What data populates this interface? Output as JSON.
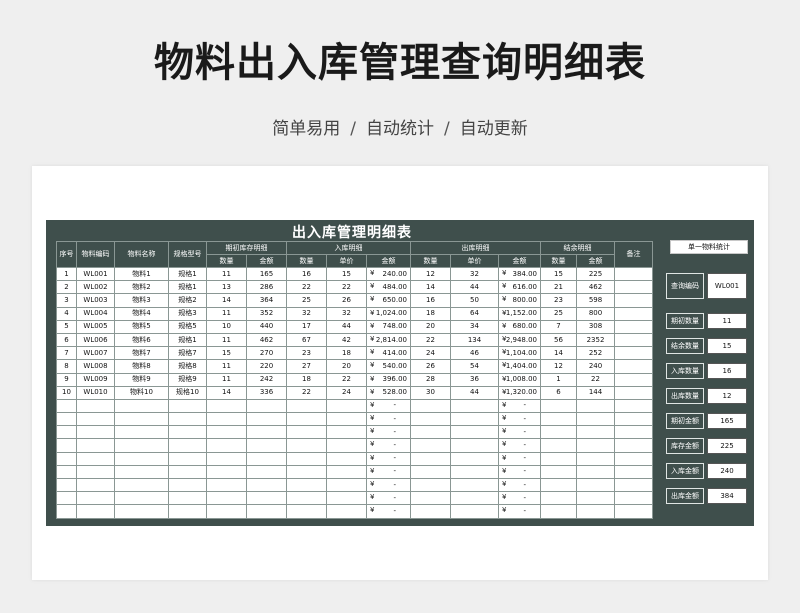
{
  "page": {
    "title": "物料出入库管理查询明细表",
    "subtitle": [
      "简单易用",
      "自动统计",
      "自动更新"
    ],
    "separator": "/"
  },
  "sheet": {
    "title": "出入库管理明细表",
    "headers": {
      "seq": "序号",
      "code": "物料编码",
      "name": "物料名称",
      "spec": "规格型号",
      "opening": "期初库存明细",
      "in": "入库明细",
      "out": "出库明细",
      "closing": "结余明细",
      "remark": "备注",
      "qty": "数量",
      "amount": "金额",
      "price": "单价"
    },
    "currency": "¥",
    "dash": "-",
    "rows": [
      {
        "seq": "1",
        "code": "WL001",
        "name": "物料1",
        "spec": "规格1",
        "o_qty": "11",
        "o_amt": "165",
        "i_qty": "16",
        "i_price": "15",
        "i_amt": "240.00",
        "x_qty": "12",
        "x_price": "32",
        "x_amt": "384.00",
        "c_qty": "15",
        "c_amt": "225"
      },
      {
        "seq": "2",
        "code": "WL002",
        "name": "物料2",
        "spec": "规格1",
        "o_qty": "13",
        "o_amt": "286",
        "i_qty": "22",
        "i_price": "22",
        "i_amt": "484.00",
        "x_qty": "14",
        "x_price": "44",
        "x_amt": "616.00",
        "c_qty": "21",
        "c_amt": "462"
      },
      {
        "seq": "3",
        "code": "WL003",
        "name": "物料3",
        "spec": "规格2",
        "o_qty": "14",
        "o_amt": "364",
        "i_qty": "25",
        "i_price": "26",
        "i_amt": "650.00",
        "x_qty": "16",
        "x_price": "50",
        "x_amt": "800.00",
        "c_qty": "23",
        "c_amt": "598"
      },
      {
        "seq": "4",
        "code": "WL004",
        "name": "物料4",
        "spec": "规格3",
        "o_qty": "11",
        "o_amt": "352",
        "i_qty": "32",
        "i_price": "32",
        "i_amt": "1,024.00",
        "x_qty": "18",
        "x_price": "64",
        "x_amt": "1,152.00",
        "c_qty": "25",
        "c_amt": "800"
      },
      {
        "seq": "5",
        "code": "WL005",
        "name": "物料5",
        "spec": "规格5",
        "o_qty": "10",
        "o_amt": "440",
        "i_qty": "17",
        "i_price": "44",
        "i_amt": "748.00",
        "x_qty": "20",
        "x_price": "34",
        "x_amt": "680.00",
        "c_qty": "7",
        "c_amt": "308"
      },
      {
        "seq": "6",
        "code": "WL006",
        "name": "物料6",
        "spec": "规格1",
        "o_qty": "11",
        "o_amt": "462",
        "i_qty": "67",
        "i_price": "42",
        "i_amt": "2,814.00",
        "x_qty": "22",
        "x_price": "134",
        "x_amt": "2,948.00",
        "c_qty": "56",
        "c_amt": "2352"
      },
      {
        "seq": "7",
        "code": "WL007",
        "name": "物料7",
        "spec": "规格7",
        "o_qty": "15",
        "o_amt": "270",
        "i_qty": "23",
        "i_price": "18",
        "i_amt": "414.00",
        "x_qty": "24",
        "x_price": "46",
        "x_amt": "1,104.00",
        "c_qty": "14",
        "c_amt": "252"
      },
      {
        "seq": "8",
        "code": "WL008",
        "name": "物料8",
        "spec": "规格8",
        "o_qty": "11",
        "o_amt": "220",
        "i_qty": "27",
        "i_price": "20",
        "i_amt": "540.00",
        "x_qty": "26",
        "x_price": "54",
        "x_amt": "1,404.00",
        "c_qty": "12",
        "c_amt": "240"
      },
      {
        "seq": "9",
        "code": "WL009",
        "name": "物料9",
        "spec": "规格9",
        "o_qty": "11",
        "o_amt": "242",
        "i_qty": "18",
        "i_price": "22",
        "i_amt": "396.00",
        "x_qty": "28",
        "x_price": "36",
        "x_amt": "1,008.00",
        "c_qty": "1",
        "c_amt": "22"
      },
      {
        "seq": "10",
        "code": "WL010",
        "name": "物料10",
        "spec": "规格10",
        "o_qty": "14",
        "o_amt": "336",
        "i_qty": "22",
        "i_price": "24",
        "i_amt": "528.00",
        "x_qty": "30",
        "x_price": "44",
        "x_amt": "1,320.00",
        "c_qty": "6",
        "c_amt": "144"
      }
    ],
    "empty_row_count": 9
  },
  "side": {
    "header": "单一物料统计",
    "items": [
      {
        "label": "查询编码",
        "value": "WL001"
      },
      {
        "label": "期初数量",
        "value": "11"
      },
      {
        "label": "结余数量",
        "value": "15"
      },
      {
        "label": "入库数量",
        "value": "16"
      },
      {
        "label": "出库数量",
        "value": "12"
      },
      {
        "label": "期初金额",
        "value": "165"
      },
      {
        "label": "库存金额",
        "value": "225"
      },
      {
        "label": "入库金额",
        "value": "240"
      },
      {
        "label": "出库金额",
        "value": "384"
      }
    ]
  }
}
